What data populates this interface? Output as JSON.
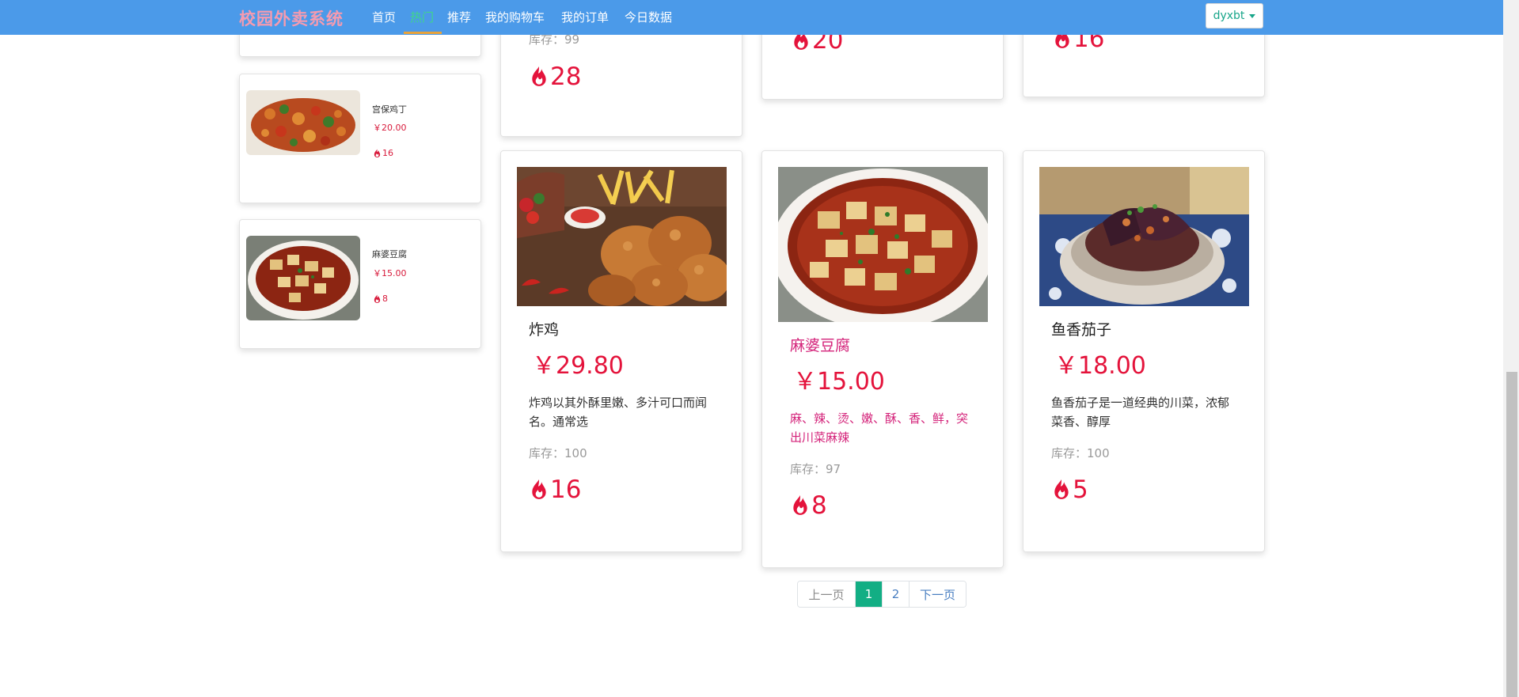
{
  "navbar": {
    "brand": "校园外卖系统",
    "links": [
      "首页",
      "热门",
      "推荐",
      "我的购物车",
      "我的订单",
      "今日数据"
    ],
    "active_index": 1,
    "user": "dyxbt"
  },
  "sidebar": {
    "items": [
      {
        "name": "宫保鸡丁",
        "price": "￥20.00",
        "hot": "16"
      },
      {
        "name": "麻婆豆腐",
        "price": "￥15.00",
        "hot": "8"
      }
    ]
  },
  "top_row": {
    "col1": {
      "stock": "库存：99",
      "hot": "28"
    },
    "col2": {
      "hot": "20"
    },
    "col3": {
      "hot": "16"
    }
  },
  "dishes": [
    {
      "name": "炸鸡",
      "price": "￥29.80",
      "desc": "炸鸡以其外酥里嫩、多汁可口而闻名。通常选",
      "stock": "库存：100",
      "hot": "16"
    },
    {
      "name": "麻婆豆腐",
      "price": "￥15.00",
      "desc": "麻、辣、烫、嫩、酥、香、鲜，突出川菜麻辣",
      "stock": "库存：97",
      "hot": "8"
    },
    {
      "name": "鱼香茄子",
      "price": "￥18.00",
      "desc": "鱼香茄子是一道经典的川菜，浓郁菜香、醇厚",
      "stock": "库存：100",
      "hot": "5"
    }
  ],
  "pagination": {
    "prev": "上一页",
    "pages": [
      "1",
      "2"
    ],
    "current": "1",
    "next": "下一页"
  },
  "colors": {
    "navbar": "#4b9ae9",
    "brand": "#f49bb0",
    "active_link": "#3fd68a",
    "price": "#e4133b",
    "highlight_text": "#d4237a",
    "page_active": "#12ae84"
  },
  "icons": {
    "hot": "fire-icon",
    "dropdown": "caret-down-icon"
  }
}
